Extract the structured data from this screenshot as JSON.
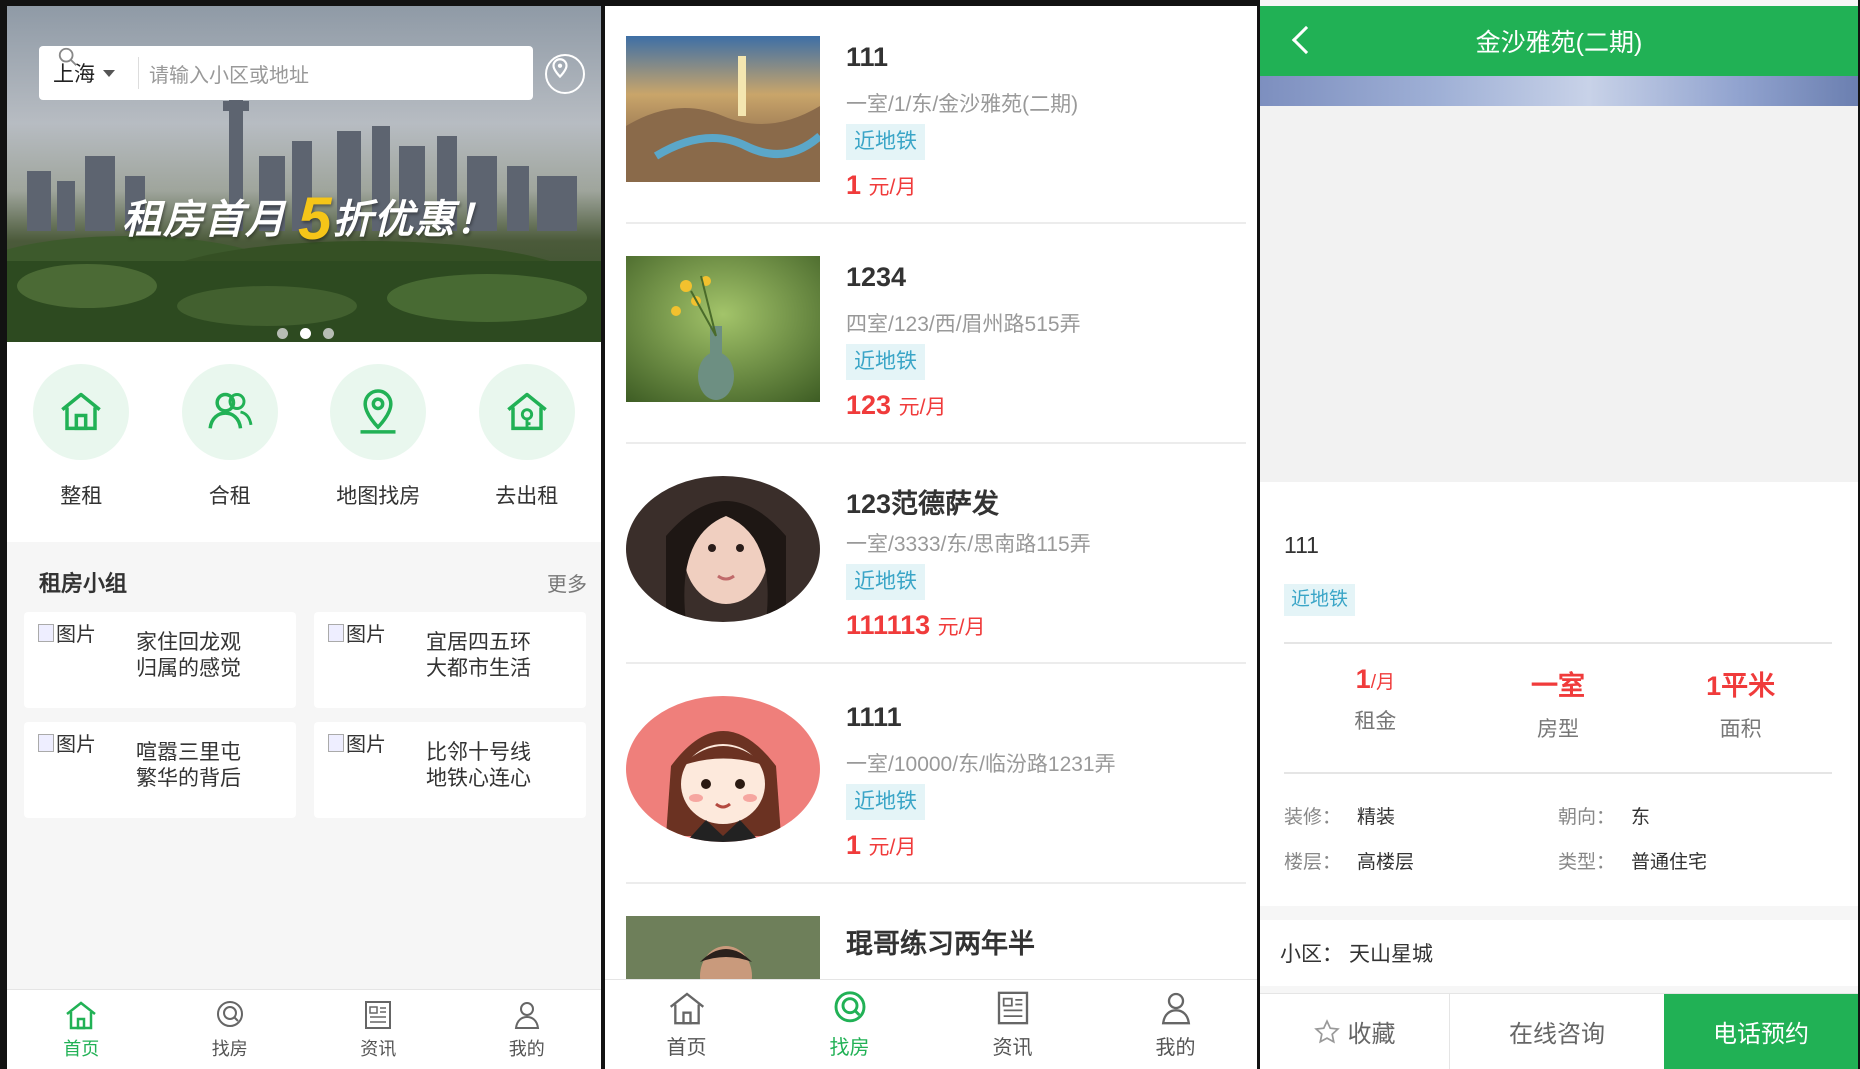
{
  "colors": {
    "brand_green": "#21b155",
    "price_red": "#f03b3b",
    "tag_blue": "#3aa5c7",
    "tag_bg": "#e4f4f7"
  },
  "home": {
    "city": "上海",
    "search_placeholder": "请输入小区或地址",
    "banner_text_a": "租房首月",
    "banner_text_big": "5",
    "banner_text_b": "折优惠！",
    "banner_dots": 3,
    "banner_active_dot": 1,
    "quick_nav": [
      {
        "label": "整租",
        "icon": "house-icon"
      },
      {
        "label": "合租",
        "icon": "people-icon"
      },
      {
        "label": "地图找房",
        "icon": "map-pin-icon"
      },
      {
        "label": "去出租",
        "icon": "house-key-icon"
      }
    ],
    "group_title": "租房小组",
    "group_more": "更多",
    "group_cards": [
      {
        "img_alt": "图片",
        "line1": "家住回龙观",
        "line2": "归属的感觉"
      },
      {
        "img_alt": "图片",
        "line1": "宜居四五环",
        "line2": "大都市生活"
      },
      {
        "img_alt": "图片",
        "line1": "喧嚣三里屯",
        "line2": "繁华的背后"
      },
      {
        "img_alt": "图片",
        "line1": "比邻十号线",
        "line2": "地铁心连心"
      }
    ]
  },
  "tabs": [
    {
      "label": "首页",
      "icon": "home-icon"
    },
    {
      "label": "找房",
      "icon": "search-house-icon"
    },
    {
      "label": "资讯",
      "icon": "news-icon"
    },
    {
      "label": "我的",
      "icon": "user-icon"
    }
  ],
  "listings": [
    {
      "title": "111",
      "desc": "一室/1/东/金沙雅苑(二期)",
      "tag": "近地铁",
      "price": "1",
      "unit": "元/月"
    },
    {
      "title": "1234",
      "desc": "四室/123/西/眉州路515弄",
      "tag": "近地铁",
      "price": "123",
      "unit": "元/月"
    },
    {
      "title": "123范德萨发",
      "desc": "一室/3333/东/思南路115弄",
      "tag": "近地铁",
      "price": "111113",
      "unit": "元/月"
    },
    {
      "title": "1111",
      "desc": "一室/10000/东/临汾路1231弄",
      "tag": "近地铁",
      "price": "1",
      "unit": "元/月"
    },
    {
      "title": "琨哥练习两年半",
      "desc": "",
      "tag": "",
      "price": "",
      "unit": ""
    }
  ],
  "detail": {
    "header_title": "金沙雅苑(二期)",
    "title": "111",
    "tag": "近地铁",
    "rent_value": "1",
    "rent_unit": "/月",
    "rent_label": "租金",
    "layout_value": "一室",
    "layout_label": "房型",
    "area_value": "1平米",
    "area_label": "面积",
    "attrs": [
      {
        "k": "装修：",
        "v": "精装"
      },
      {
        "k": "朝向：",
        "v": "东"
      },
      {
        "k": "楼层：",
        "v": "高楼层"
      },
      {
        "k": "类型：",
        "v": "普通住宅"
      }
    ],
    "community_label": "小区：",
    "community_value": "天山星城",
    "fav": "收藏",
    "chat": "在线咨询",
    "call": "电话预约"
  }
}
